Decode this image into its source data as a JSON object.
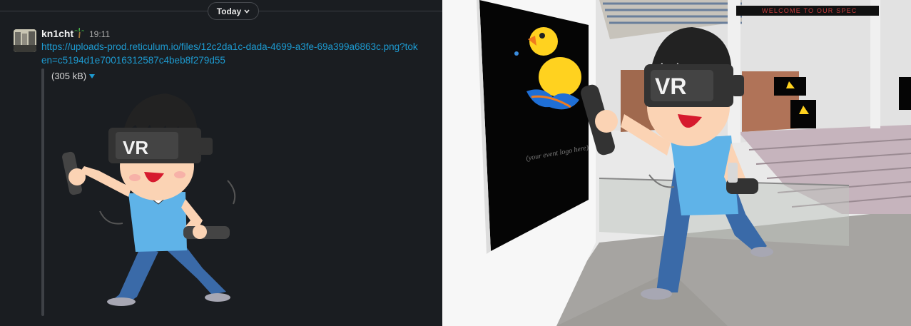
{
  "chat": {
    "day_divider": "Today",
    "message": {
      "username": "kn1cht",
      "status_emoji": "palm-tree-icon",
      "time": "19:11",
      "link": "https://uploads-prod.reticulum.io/files/12c2da1c-dada-4699-a3fe-69a399a6863c.png?token=c5194d1e70016312587c4beb8f279d55",
      "attachment_size": "(305 kB)",
      "attachment_preview": "vr-character-illustration"
    }
  },
  "scene": {
    "banner_text": "WELCOME TO OUR SPEC",
    "poster_caption": "(your event logo here)",
    "poster_image": "duck-logo",
    "headset_label": "VR"
  },
  "colors": {
    "chat_bg": "#1a1d21",
    "link": "#1d9bd1",
    "username": "#f2f2f2",
    "banner_text": "#c23b3b",
    "shirt": "#5fb3e8",
    "pants": "#3a6aa8",
    "skin": "#fbd3b4",
    "duck": "#ffd21f"
  }
}
